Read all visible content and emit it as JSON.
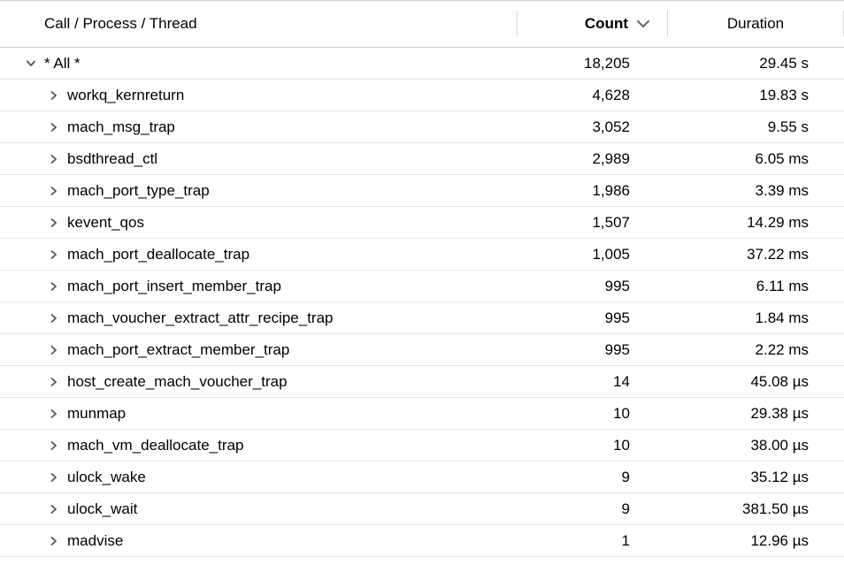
{
  "header": {
    "name_label": "Call / Process / Thread",
    "count_label": "Count",
    "duration_label": "Duration"
  },
  "summary": {
    "label": "* All *",
    "count": "18,205",
    "duration": "29.45 s"
  },
  "rows": [
    {
      "name": "workq_kernreturn",
      "count": "4,628",
      "duration": "19.83 s"
    },
    {
      "name": "mach_msg_trap",
      "count": "3,052",
      "duration": "9.55 s"
    },
    {
      "name": "bsdthread_ctl",
      "count": "2,989",
      "duration": "6.05 ms"
    },
    {
      "name": "mach_port_type_trap",
      "count": "1,986",
      "duration": "3.39 ms"
    },
    {
      "name": "kevent_qos",
      "count": "1,507",
      "duration": "14.29 ms"
    },
    {
      "name": "mach_port_deallocate_trap",
      "count": "1,005",
      "duration": "37.22 ms"
    },
    {
      "name": "mach_port_insert_member_trap",
      "count": "995",
      "duration": "6.11 ms"
    },
    {
      "name": "mach_voucher_extract_attr_recipe_trap",
      "count": "995",
      "duration": "1.84 ms"
    },
    {
      "name": "mach_port_extract_member_trap",
      "count": "995",
      "duration": "2.22 ms"
    },
    {
      "name": "host_create_mach_voucher_trap",
      "count": "14",
      "duration": "45.08 µs"
    },
    {
      "name": "munmap",
      "count": "10",
      "duration": "29.38 µs"
    },
    {
      "name": "mach_vm_deallocate_trap",
      "count": "10",
      "duration": "38.00 µs"
    },
    {
      "name": "ulock_wake",
      "count": "9",
      "duration": "35.12 µs"
    },
    {
      "name": "ulock_wait",
      "count": "9",
      "duration": "381.50 µs"
    },
    {
      "name": "madvise",
      "count": "1",
      "duration": "12.96 µs"
    }
  ]
}
